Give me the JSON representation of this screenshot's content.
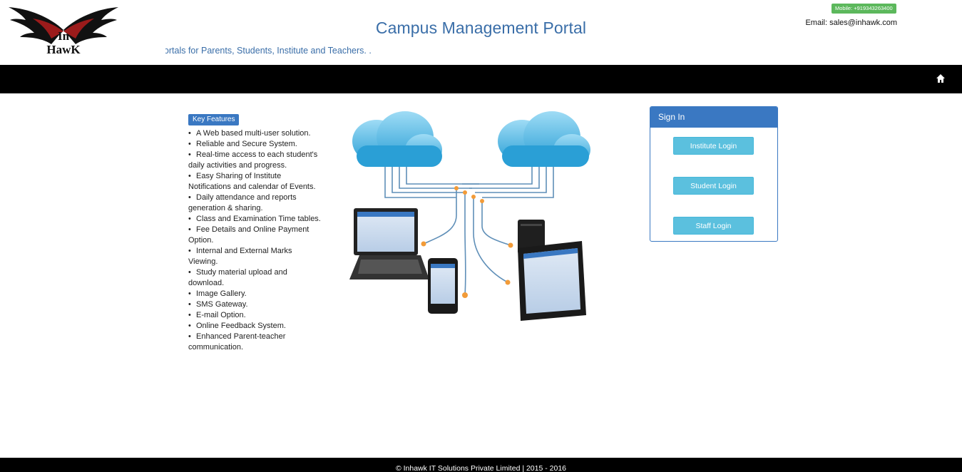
{
  "header": {
    "logo_text_top": "In",
    "logo_text_bottom": "HawK",
    "title": "Campus Management Portal",
    "marquee": "Web portals for Parents, Students, Institute and Teachers. .",
    "mobile": "Mobile: +919343263400",
    "email": "Email: sales@inhawk.com"
  },
  "navbar": {
    "home_icon": "home-icon"
  },
  "features": {
    "badge": "Key Features",
    "items": [
      "A Web based multi-user solution.",
      "Reliable and Secure System.",
      "Real-time access to each student's daily activities and progress.",
      "Easy Sharing of Institute Notifications and calendar of Events.",
      "Daily attendance and reports generation & sharing.",
      "Class and Examination Time tables.",
      "Fee Details and Online Payment Option.",
      "Internal and External Marks Viewing.",
      "Study material upload and download.",
      "Image Gallery.",
      "SMS Gateway.",
      "E-mail Option.",
      "Online Feedback System.",
      "Enhanced Parent-teacher communication."
    ]
  },
  "signin": {
    "title": "Sign In",
    "buttons": [
      "Institute Login",
      "Student Login",
      "Staff Login"
    ]
  },
  "footer": {
    "text": "© Inhawk IT Solutions Private Limited | 2015 - 2016"
  },
  "colors": {
    "accent": "#3a78c2",
    "title": "#3a6ea8",
    "login_button": "#5bc0de",
    "mobile_badge": "#5cb85c"
  }
}
